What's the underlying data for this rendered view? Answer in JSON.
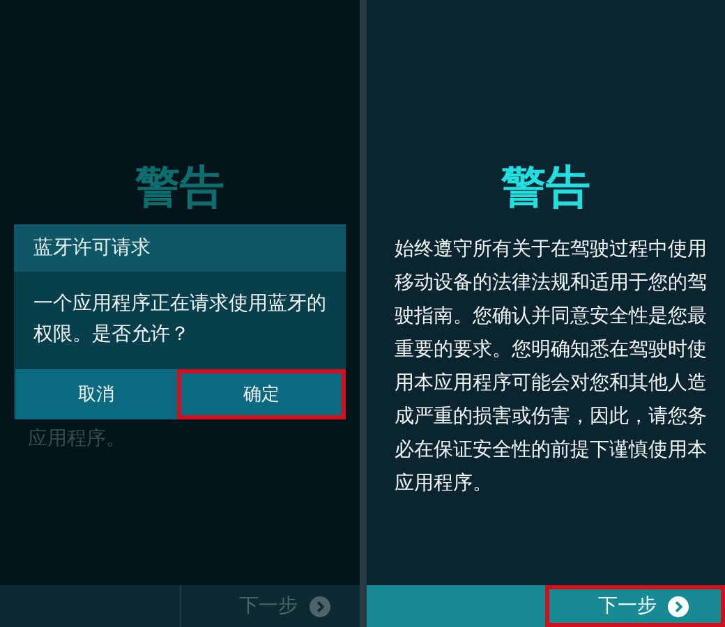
{
  "screens": [
    {
      "title": "警告",
      "body": "应用程序。",
      "body_dimmed": true,
      "dialog": {
        "title": "蓝牙许可请求",
        "message": "一个应用程序正在请求使用蓝牙的权限。是否允许？",
        "buttons": [
          {
            "label": "取消",
            "highlighted": false
          },
          {
            "label": "确定",
            "highlighted": true
          }
        ]
      },
      "next_button": {
        "label": "下一步",
        "disabled": true,
        "highlighted": false
      }
    },
    {
      "title": "警告",
      "body": "始终遵守所有关于在驾驶过程中使用移动设备的法律法规和适用于您的驾驶指南。您确认并同意安全性是您最重要的要求。您明确知悉在驾驶时使用本应用程序可能会对您和其他人造成严重的损害或伤害，因此，请您务必在保证安全性的前提下谨慎使用本应用程序。",
      "body_dimmed": false,
      "next_button": {
        "label": "下一步",
        "disabled": false,
        "highlighted": true
      }
    }
  ]
}
